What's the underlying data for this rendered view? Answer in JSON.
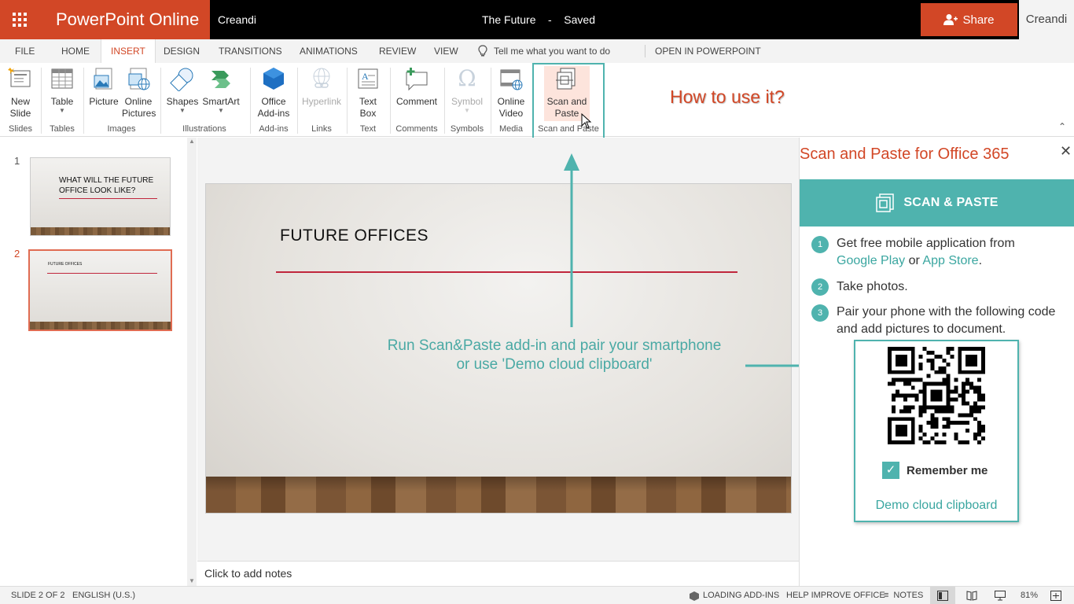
{
  "titlebar": {
    "app_name": "PowerPoint Online",
    "tenant": "Creandi",
    "doc_title": "The Future",
    "separator": "-",
    "save_status": "Saved",
    "share_label": "Share",
    "user": "Creandi",
    "accent": "#d24726"
  },
  "menu": {
    "tabs": [
      "FILE",
      "HOME",
      "INSERT",
      "DESIGN",
      "TRANSITIONS",
      "ANIMATIONS",
      "REVIEW",
      "VIEW"
    ],
    "active_tab": "INSERT",
    "tell_me": "Tell me what you want to do",
    "open_in": "OPEN IN POWERPOINT"
  },
  "ribbon": {
    "buttons": {
      "new_slide": "New Slide",
      "table": "Table",
      "picture": "Picture",
      "online_pictures": "Online Pictures",
      "shapes": "Shapes",
      "smartart": "SmartArt",
      "office_addins": "Office Add-ins",
      "hyperlink": "Hyperlink",
      "text_box": "Text Box",
      "comment": "Comment",
      "symbol": "Symbol",
      "online_video": "Online Video",
      "scan_paste": "Scan and Paste"
    },
    "groups": {
      "slides": "Slides",
      "tables": "Tables",
      "images": "Images",
      "illustrations": "Illustrations",
      "addins": "Add-ins",
      "links": "Links",
      "text": "Text",
      "comments": "Comments",
      "symbols": "Symbols",
      "media": "Media",
      "scan_paste": "Scan and Paste"
    },
    "annotation": "How to use it?"
  },
  "thumbnails": [
    {
      "number": "1",
      "title": "WHAT WILL THE FUTURE OFFICE LOOK LIKE?"
    },
    {
      "number": "2",
      "title": "FUTURE OFFICES"
    }
  ],
  "slide": {
    "title": "FUTURE OFFICES",
    "notes_placeholder": "Click to add notes"
  },
  "annotation": {
    "line1": "Run Scan&Paste add-in and pair your smartphone",
    "line2": "or use 'Demo cloud clipboard'"
  },
  "taskpane": {
    "title": "Scan and Paste for Office 365",
    "banner": "SCAN & PASTE",
    "steps": [
      {
        "num": "1",
        "text_a": "Get free mobile application from",
        "link1": "Google Play",
        "or": "or",
        "link2": "App Store",
        "end": "."
      },
      {
        "num": "2",
        "text": "Take photos."
      },
      {
        "num": "3",
        "text": "Pair your phone with the following code and add pictures to document."
      }
    ],
    "remember_label": "Remember me",
    "remember_checked": true,
    "demo_link": "Demo cloud clipboard",
    "teal": "#4fb3ae"
  },
  "statusbar": {
    "slide_info": "SLIDE 2 OF 2",
    "language": "ENGLISH (U.S.)",
    "loading": "LOADING ADD-INS",
    "help": "HELP IMPROVE OFFICE",
    "notes": "NOTES",
    "zoom": "81%"
  }
}
